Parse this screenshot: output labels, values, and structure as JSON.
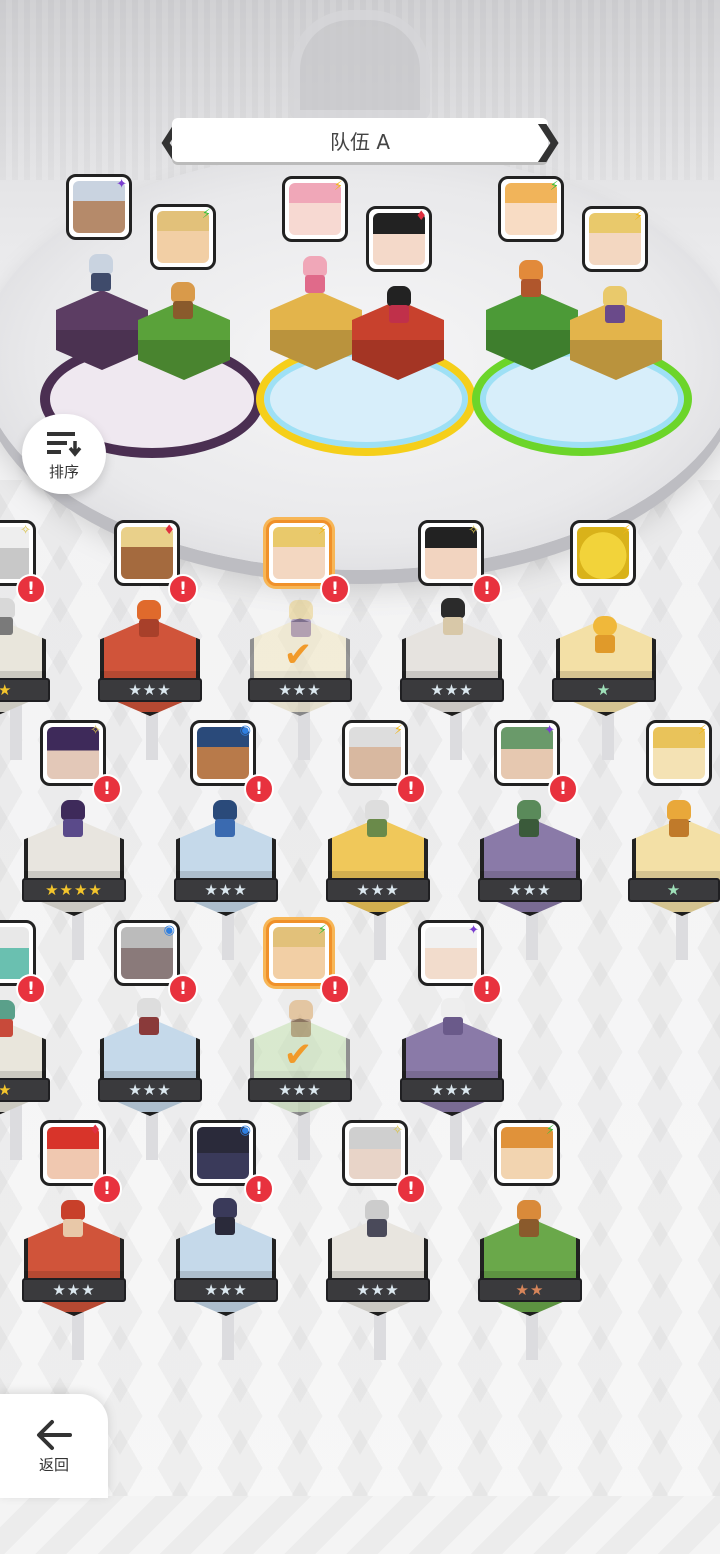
{
  "team": {
    "title": "队伍 A"
  },
  "sort_button": {
    "label": "排序"
  },
  "back_button": {
    "label": "返回"
  },
  "team_slots": [
    {
      "color": "#4b2f52",
      "portraits": [
        {
          "face": "#8f9fb7",
          "hair": "#c9d3e0",
          "element": "✦",
          "element_color": "#7a3fd0"
        },
        {
          "face": "#f2cfa5",
          "hair": "#e2c17a",
          "element": "⚡",
          "element_color": "#3cbf3a"
        }
      ]
    },
    {
      "color": "#f5cf1a",
      "portraits": [
        {
          "face": "#f7d9d2",
          "hair": "#f0a7b8",
          "element": "⚡",
          "element_color": "#f0b71a"
        },
        {
          "face": "#f4d9c9",
          "hair": "#222222",
          "element": "♦",
          "element_color": "#e03040"
        }
      ]
    },
    {
      "color": "#6cd52a",
      "portraits": [
        {
          "face": "#f8dcc4",
          "hair": "#f1b45a",
          "element": "⚡",
          "element_color": "#3cbf3a"
        },
        {
          "face": "#f3d7c1",
          "hair": "#e9c96b",
          "element": "⚡",
          "element_color": "#f0b71a"
        }
      ]
    }
  ],
  "roster": [
    {
      "stars": "★★",
      "star_style": "gold"
    },
    {
      "stars": "★★★",
      "star_style": "silver"
    },
    {
      "stars": "★★★",
      "star_style": "silver"
    },
    {
      "stars": "★★★",
      "star_style": "silver"
    },
    {
      "stars": "★",
      "star_style": "green"
    },
    {
      "stars": "★★★★",
      "star_style": "gold"
    },
    {
      "stars": "★★★",
      "star_style": "silver"
    },
    {
      "stars": "★★★",
      "star_style": "silver"
    },
    {
      "stars": "★★★",
      "star_style": "silver"
    },
    {
      "stars": "★",
      "star_style": "green"
    },
    {
      "stars": "★★",
      "star_style": "gold"
    },
    {
      "stars": "★★★",
      "star_style": "silver"
    },
    {
      "stars": "★★★",
      "star_style": "silver"
    },
    {
      "stars": "★★★",
      "star_style": "silver"
    },
    {
      "stars": "★★★",
      "star_style": "silver"
    },
    {
      "stars": "★★★",
      "star_style": "silver"
    },
    {
      "stars": "★★★",
      "star_style": "silver"
    },
    {
      "stars": "★★",
      "star_style": "bronze"
    }
  ],
  "alert_glyph": "!",
  "check_glyph": "✔"
}
